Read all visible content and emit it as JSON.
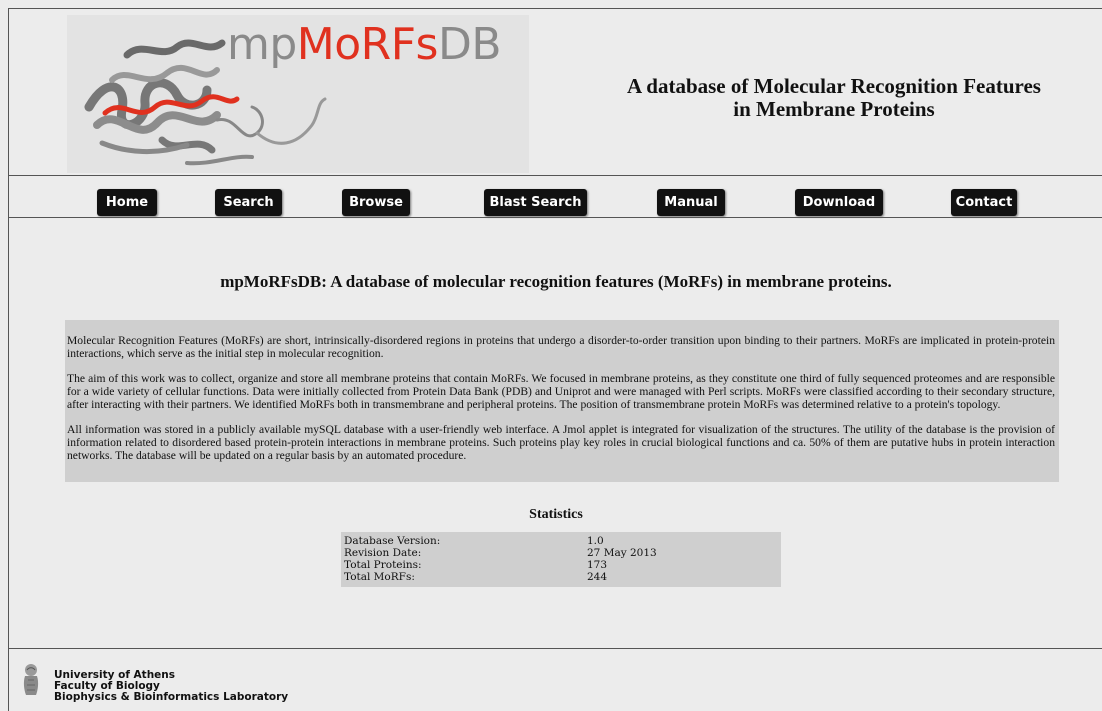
{
  "header": {
    "logo_prefix": "mp",
    "logo_accent": "MoRFs",
    "logo_suffix": "DB",
    "tagline_line1": "A database of Molecular Recognition Features",
    "tagline_line2": "in Membrane Proteins"
  },
  "nav": {
    "items": [
      "Home",
      "Search",
      "Browse",
      "Blast Search",
      "Manual",
      "Download",
      "Contact"
    ]
  },
  "main": {
    "title": "mpMoRFsDB: A database of molecular recognition features (MoRFs) in membrane proteins.",
    "paragraphs": [
      "Molecular Recognition Features (MoRFs) are short, intrinsically-disordered regions in proteins that undergo a disorder-to-order transition upon binding to their partners. MoRFs are implicated in protein-protein interactions, which serve as the initial step in molecular recognition.",
      "The aim of this work was to collect, organize and store all membrane proteins that contain MoRFs. We focused in membrane proteins, as they constitute one third of fully sequenced proteomes and are responsible for a wide variety of cellular functions. Data were initially collected from Protein Data Bank (PDB) and Uniprot and were managed with Perl scripts. MoRFs were classified according to their secondary structure, after interacting with their partners. We identified MoRFs both in transmembrane and peripheral proteins. The position of transmembrane protein MoRFs was determined relative to a protein's topology.",
      "All information was stored in a publicly available mySQL database with a user-friendly web interface. A Jmol applet is integrated for visualization of the structures. The utility of the database is the provision of information related to disordered based protein-protein interactions in membrane proteins. Such proteins play key roles in crucial biological functions and ca. 50% of them are putative hubs in protein interaction networks. The database will be updated on a regular basis by an automated procedure."
    ]
  },
  "stats": {
    "title": "Statistics",
    "rows": [
      {
        "label": "Database Version:",
        "value": "1.0"
      },
      {
        "label": "Revision Date:",
        "value": "27 May 2013"
      },
      {
        "label": "Total Proteins:",
        "value": "173"
      },
      {
        "label": "Total MoRFs:",
        "value": "244"
      }
    ]
  },
  "footer": {
    "line1": "University of Athens",
    "line2": "Faculty of Biology",
    "line3": "Biophysics & Bioinformatics Laboratory"
  },
  "colors": {
    "accent": "#e0311f",
    "background": "#ececec",
    "panel": "#cfcfcf",
    "button": "#111111"
  }
}
